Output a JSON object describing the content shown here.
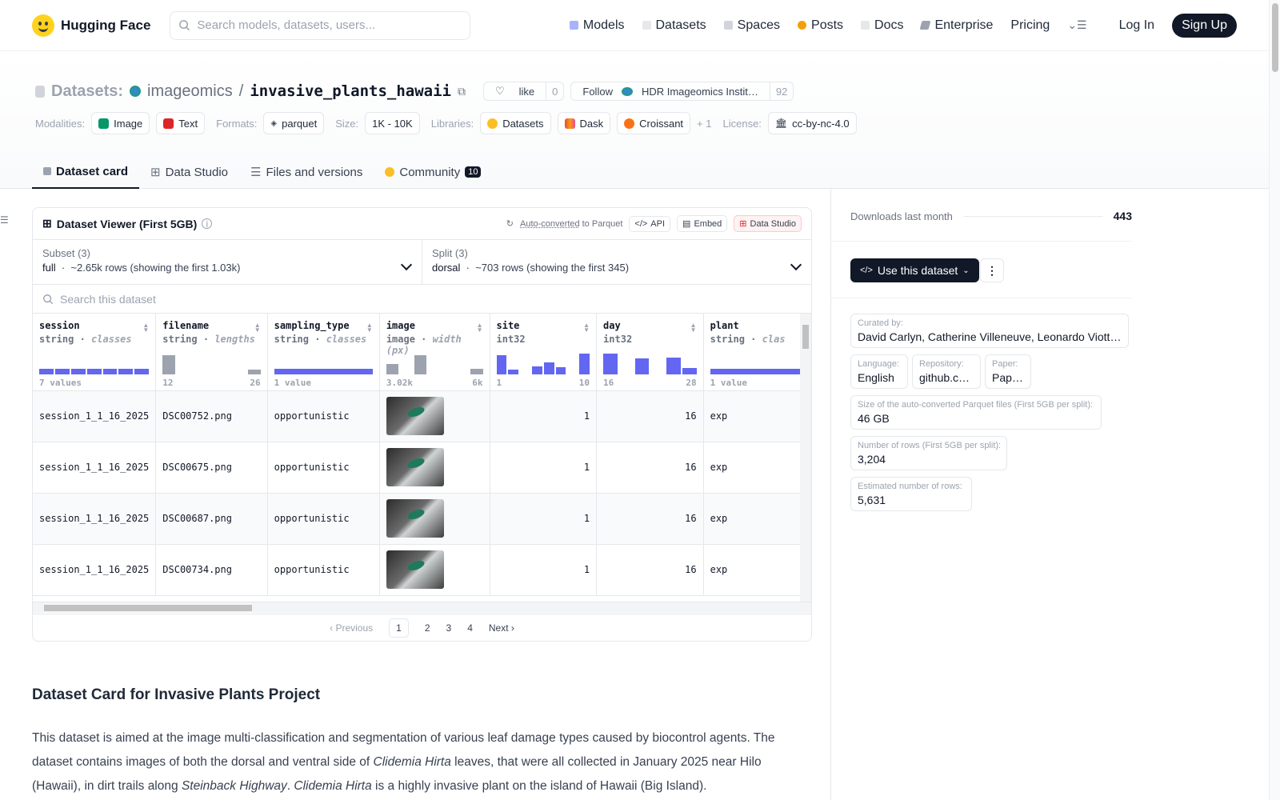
{
  "nav": {
    "brand": "Hugging Face",
    "search_placeholder": "Search models, datasets, users...",
    "links": [
      "Models",
      "Datasets",
      "Spaces",
      "Posts",
      "Docs",
      "Enterprise",
      "Pricing"
    ],
    "login": "Log In",
    "signup": "Sign Up"
  },
  "repo": {
    "type_label": "Datasets:",
    "org": "imageomics",
    "slash": "/",
    "name": "invasive_plants_hawaii",
    "like_label": "like",
    "like_count": "0",
    "follow_label": "Follow",
    "follow_org": "HDR Imageomics Instit…",
    "follow_count": "92"
  },
  "meta": {
    "modalities_label": "Modalities:",
    "modalities": [
      "Image",
      "Text"
    ],
    "formats_label": "Formats:",
    "format": "parquet",
    "size_label": "Size:",
    "size": "1K - 10K",
    "libraries_label": "Libraries:",
    "libraries": [
      "Datasets",
      "Dask",
      "Croissant"
    ],
    "libraries_more": "+ 1",
    "license_label": "License:",
    "license": "cc-by-nc-4.0"
  },
  "tabs": [
    "Dataset card",
    "Data Studio",
    "Files and versions",
    "Community"
  ],
  "community_count": "10",
  "viewer": {
    "title": "Dataset Viewer (First 5GB)",
    "auto_converted": "Auto-converted",
    "to_parquet": "to Parquet",
    "api": "API",
    "embed": "Embed",
    "data_studio": "Data Studio",
    "subset_label": "Subset (3)",
    "subset_value": "full",
    "subset_rows": "~2.65k rows (showing the first 1.03k)",
    "split_label": "Split (3)",
    "split_value": "dorsal",
    "split_rows": "~703 rows (showing the first 345)",
    "search_placeholder": "Search this dataset",
    "columns": [
      {
        "name": "session",
        "type": "string",
        "hint": "classes",
        "range_left": "7 values",
        "range_right": ""
      },
      {
        "name": "filename",
        "type": "string",
        "hint": "lengths",
        "range_left": "12",
        "range_right": "26"
      },
      {
        "name": "sampling_type",
        "type": "string",
        "hint": "classes",
        "range_left": "1 value",
        "range_right": ""
      },
      {
        "name": "image",
        "type": "image",
        "hint": "width (px)",
        "range_left": "3.02k",
        "range_right": "6k"
      },
      {
        "name": "site",
        "type": "int32",
        "hint": "",
        "range_left": "1",
        "range_right": "10"
      },
      {
        "name": "day",
        "type": "int32",
        "hint": "",
        "range_left": "16",
        "range_right": "28"
      },
      {
        "name": "plant",
        "type": "string",
        "hint": "clas",
        "range_left": "1 value",
        "range_right": ""
      }
    ],
    "rows": [
      {
        "session": "session_1_1_16_2025",
        "filename": "DSC00752.png",
        "sampling_type": "opportunistic",
        "site": "1",
        "day": "16",
        "plant": "exp"
      },
      {
        "session": "session_1_1_16_2025",
        "filename": "DSC00675.png",
        "sampling_type": "opportunistic",
        "site": "1",
        "day": "16",
        "plant": "exp"
      },
      {
        "session": "session_1_1_16_2025",
        "filename": "DSC00687.png",
        "sampling_type": "opportunistic",
        "site": "1",
        "day": "16",
        "plant": "exp"
      },
      {
        "session": "session_1_1_16_2025",
        "filename": "DSC00734.png",
        "sampling_type": "opportunistic",
        "site": "1",
        "day": "16",
        "plant": "exp"
      }
    ],
    "pager": {
      "prev": "Previous",
      "pages": [
        "1",
        "2",
        "3",
        "4"
      ],
      "next": "Next"
    }
  },
  "card": {
    "heading": "Dataset Card for Invasive Plants Project",
    "p1": "This dataset is aimed at the image multi-classification and segmentation of various leaf damage types caused by biocontrol agents. The dataset contains images of both the dorsal and ventral side of ",
    "species": "Clidemia Hirta",
    "p2": " leaves, that were all collected in January 2025 near Hilo (Hawaii), in dirt trails along ",
    "place": "Steinback Highway",
    "p3": ". ",
    "p4": " is a highly invasive plant on the island of Hawaii (Big Island)."
  },
  "sidebar": {
    "downloads_label": "Downloads last month",
    "downloads": "443",
    "use_dataset": "Use this dataset",
    "curated_label": "Curated by:",
    "curated": "David Carlyn, Catherine Villeneuve, Leonardo Viotti, Ell…",
    "language_label": "Language:",
    "language": "English",
    "repository_label": "Repository:",
    "repository": "github.com",
    "paper_label": "Paper:",
    "paper": "Paper:",
    "parquet_size_label": "Size of the auto-converted Parquet files (First 5GB per split):",
    "parquet_size": "46 GB",
    "num_rows_label": "Number of rows (First 5GB per split):",
    "num_rows": "3,204",
    "est_rows_label": "Estimated number of rows:",
    "est_rows": "5,631"
  },
  "colors": {
    "accent": "#6366f1",
    "hist_gray": "#9ca3af",
    "dark": "#111827"
  }
}
